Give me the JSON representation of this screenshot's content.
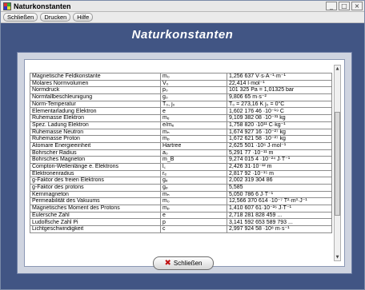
{
  "window": {
    "title": "Naturkonstanten"
  },
  "titlebar_buttons": {
    "minimize": "_",
    "maximize": "□",
    "close": "×"
  },
  "menu": [
    "Schließen",
    "Drucken",
    "Hilfe"
  ],
  "header": {
    "title": "Naturkonstanten"
  },
  "table": {
    "rows": [
      [
        "Magnetische Feldkonstante",
        "m₀",
        "1,256 637 V·s·A⁻¹·m⁻¹"
      ],
      [
        "Molares Normvolumen",
        "V₀",
        "22,414 l·mol⁻¹"
      ],
      [
        "Normdruck",
        "p₀",
        "101 325 Pa = 1,01325 bar"
      ],
      [
        "Normfallbeschleunigung",
        "g₀",
        "9,806 65 m·s⁻²"
      ],
      [
        "Norm-Temperatur",
        "T₀, j₀",
        "T₀ = 273,16 K   j₀ = 0°C"
      ],
      [
        "Elementarladung Elektron",
        "e",
        "1,602 176 46 ·10⁻¹⁹ C"
      ],
      [
        "Ruhemasse Elektron",
        "mₑ",
        "9,109 382 08 ·10⁻³¹ kg"
      ],
      [
        "Spez. Ladung Elektron",
        "e/mₑ",
        "1,758 820 ·10¹¹ C·kg⁻¹"
      ],
      [
        "Ruhemasse Neutron",
        "mₙ",
        "1,674 927 16 ·10⁻²⁷ kg"
      ],
      [
        "Ruhemasse Proton",
        "mₚ",
        "1,672 621 58 ·10⁻²⁷ kg"
      ],
      [
        "Atomare Energieeinheit",
        "Hartree",
        "2,625 501 ·10⁶ J·mol⁻¹"
      ],
      [
        "Bohrscher Radius",
        "a₀",
        "5,291 77 ·10⁻¹¹ m"
      ],
      [
        "Bohrsches Magneton",
        "m_B",
        "9,274 015 4 ·10⁻²⁴ J·T⁻¹"
      ],
      [
        "Compton-Wellenlänge e. Elektrons",
        "l꜀",
        "2,426 31·10⁻¹² m"
      ],
      [
        "Elektronenradius",
        "rₑ",
        "2,817 92 ·10⁻¹⁵ m"
      ],
      [
        "g-Faktor des freien Elektrons",
        "gₑ",
        "2,002 319 304 86"
      ],
      [
        "g-Faktor des protons",
        "gₚ",
        "5,585"
      ],
      [
        "Kernmagneton",
        "mₙ",
        "5,050 786 6 J·T⁻¹"
      ],
      [
        "Permeabilität des Vakuums",
        "m₀",
        "12,566 370 614 ·10⁻⁷ T²·m³·J⁻¹"
      ],
      [
        "Magnetisches Moment des Protons",
        "mₚ",
        "1,410 607 61·10⁻²⁶ J·T⁻¹"
      ],
      [
        "Eulersche Zahl",
        "e",
        "2,718 281 828 459 ..."
      ],
      [
        "Ludolfsche Zahl Pi",
        "p",
        "3,141 592 653 589 793 ..."
      ],
      [
        "Lichtgeschwindigkeit",
        "c",
        "2,997 924 58 ·10⁸ m·s⁻¹"
      ]
    ]
  },
  "close_button": {
    "label": "Schließen",
    "icon": "close-icon"
  },
  "colors": {
    "background": "#415584",
    "panel": "#cfd4e0",
    "close_icon": "#c01010"
  }
}
